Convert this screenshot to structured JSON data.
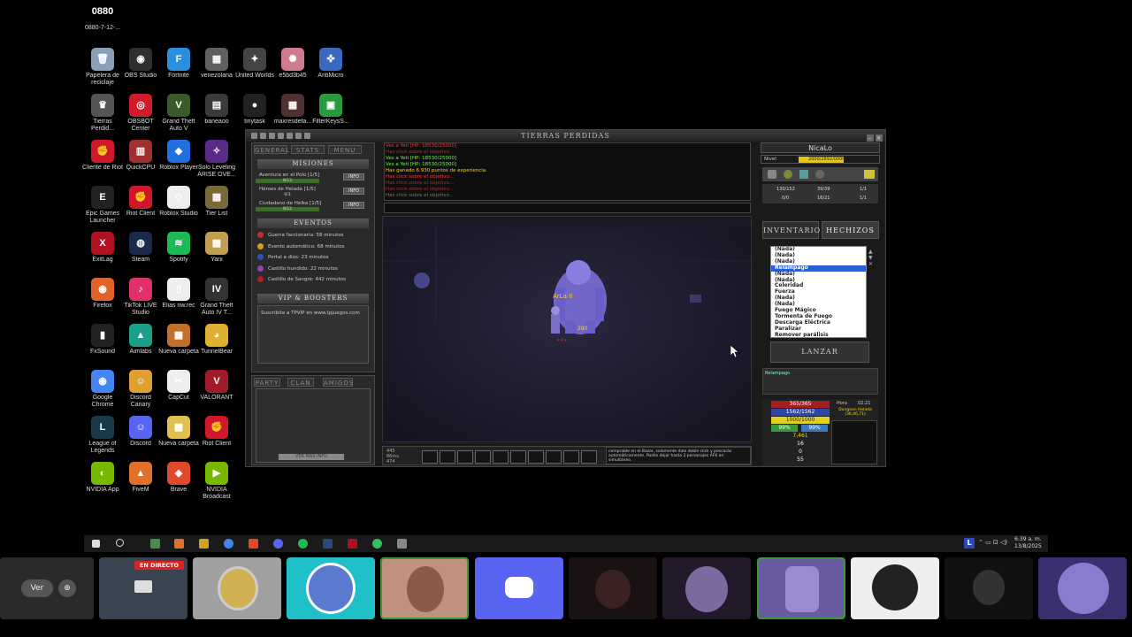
{
  "desktop_icons": [
    {
      "label": "Papelera de reciclaje",
      "color": "#8aa0b8",
      "glyph": "🗑"
    },
    {
      "label": "OBS Studio",
      "color": "#302e31",
      "glyph": "◉"
    },
    {
      "label": "Fortnite",
      "color": "#2b8fe0",
      "glyph": "F"
    },
    {
      "label": "venezolana",
      "color": "#606060",
      "glyph": "▦"
    },
    {
      "label": "United Worlds",
      "color": "#444",
      "glyph": "✦"
    },
    {
      "label": "e5bd3b45",
      "color": "#d07a90",
      "glyph": "✺"
    },
    {
      "label": "AntiMicro",
      "color": "#3a6ac0",
      "glyph": "✜"
    },
    {
      "label": "Tierras Perdid...",
      "color": "#555",
      "glyph": "♛"
    },
    {
      "label": "OBSBOT Center",
      "color": "#d01c2a",
      "glyph": "◎"
    },
    {
      "label": "Grand Theft Auto V",
      "color": "#3a5a2a",
      "glyph": "V"
    },
    {
      "label": "baneaoo",
      "color": "#3a3a3a",
      "glyph": "▤"
    },
    {
      "label": "tinytask",
      "color": "#222",
      "glyph": "●"
    },
    {
      "label": "maxresdefa...",
      "color": "#503030",
      "glyph": "▦"
    },
    {
      "label": "FilterKeysS...",
      "color": "#2a9a40",
      "glyph": "▣"
    },
    {
      "label": "Cliente de Riot",
      "color": "#d0182a",
      "glyph": "✊"
    },
    {
      "label": "QuickCPU",
      "color": "#a03030",
      "glyph": "▥"
    },
    {
      "label": "Roblox Player",
      "color": "#2070e0",
      "glyph": "◆"
    },
    {
      "label": "Solo Leveling ARISE OVE...",
      "color": "#5a2a8a",
      "glyph": "✧"
    },
    {
      "label": "Epic Games Launcher",
      "color": "#222",
      "glyph": "E"
    },
    {
      "label": "Riot Client",
      "color": "#d0182a",
      "glyph": "✊"
    },
    {
      "label": "Roblox Studio",
      "color": "#eee",
      "glyph": "◇"
    },
    {
      "label": "Tier List",
      "color": "#7a6a3a",
      "glyph": "▦"
    },
    {
      "label": "ExitLag",
      "color": "#b01020",
      "glyph": "X"
    },
    {
      "label": "Steam",
      "color": "#1a2a4a",
      "glyph": "◍"
    },
    {
      "label": "Spotify",
      "color": "#1db954",
      "glyph": "≋"
    },
    {
      "label": "Yani",
      "color": "#c0a050",
      "glyph": "▦"
    },
    {
      "label": "Firefox",
      "color": "#e0642a",
      "glyph": "◉"
    },
    {
      "label": "TikTok LIVE Studio",
      "color": "#e0306a",
      "glyph": "♪"
    },
    {
      "label": "Elias nw.rec",
      "color": "#eee",
      "glyph": "▯"
    },
    {
      "label": "Grand Theft Auto IV T...",
      "color": "#333",
      "glyph": "IV"
    },
    {
      "label": "FxSound",
      "color": "#222",
      "glyph": "▮"
    },
    {
      "label": "Aimlabs",
      "color": "#1aa08a",
      "glyph": "▲"
    },
    {
      "label": "Nueva carpeta",
      "color": "#c0702a",
      "glyph": "▦"
    },
    {
      "label": "TunnelBear",
      "color": "#e0b030",
      "glyph": "◕"
    },
    {
      "label": "Google Chrome",
      "color": "#4285f4",
      "glyph": "◉"
    },
    {
      "label": "Discord Canary",
      "color": "#e0a030",
      "glyph": "☺"
    },
    {
      "label": "CapCut",
      "color": "#eee",
      "glyph": "✂"
    },
    {
      "label": "VALORANT",
      "color": "#a01a2a",
      "glyph": "V"
    },
    {
      "label": "League of Legends",
      "color": "#1a3a4a",
      "glyph": "L"
    },
    {
      "label": "Discord",
      "color": "#5865f2",
      "glyph": "☺"
    },
    {
      "label": "Nueva carpeta",
      "color": "#e0c050",
      "glyph": "▦"
    },
    {
      "label": "Riot Client",
      "color": "#d0182a",
      "glyph": "✊"
    },
    {
      "label": "NVIDIA App",
      "color": "#76b900",
      "glyph": "◐"
    },
    {
      "label": "FiveM",
      "color": "#e0702a",
      "glyph": "▲"
    },
    {
      "label": "Brave",
      "color": "#e04a2a",
      "glyph": "◈"
    },
    {
      "label": "NVIDIA Broadcast",
      "color": "#76b900",
      "glyph": "▶"
    },
    {
      "label": "0880-7-12-...",
      "color": "#000",
      "glyph": "0880"
    }
  ],
  "game": {
    "title": "TIERRAS PERDIDAS",
    "tabs": [
      "GENERAL",
      "STATS",
      "MENU"
    ],
    "missions_header": "MISIONES",
    "missions": [
      {
        "name": "Aventura en el Polo [1/5]",
        "progress": "8/13",
        "fill": 1.0
      },
      {
        "name": "Héroes de Helada [1/5]",
        "progress": "0/3",
        "fill": 0
      },
      {
        "name": "Ciudadano de Helka [1/5]",
        "progress": "8/12",
        "fill": 1.0
      }
    ],
    "info_label": "INFO",
    "events_header": "EVENTOS",
    "events": [
      {
        "text": "Guerra faccionaria: 58 minutos",
        "color": "#c03030"
      },
      {
        "text": "Evento automático: 68 minutos",
        "color": "#d0a020"
      },
      {
        "text": "Portal a dios: 23 minutos",
        "color": "#3050c0"
      },
      {
        "text": "Castillo hundido: 22 minutos",
        "color": "#9040b0"
      },
      {
        "text": "Castillo de Sangre: 442 minutos",
        "color": "#b02020"
      }
    ],
    "vip_header": "VIP & BOOSTERS",
    "vip_text": "Suscribite a TPVIP en www.tpjuegos.com",
    "bottom_tabs": [
      "PARTY",
      "CLAN",
      "AMIGOS"
    ],
    "bottom_btn": "VER MÁS INFO",
    "chat": [
      {
        "text": "Ves a Yeti [HP: 18530/25000]",
        "color": "#ff3030"
      },
      {
        "text": "Has click sobre el objetivo...",
        "color": "#884444"
      },
      {
        "text": "Ves a Yeti [HP: 18530/25000]",
        "color": "#60ff40"
      },
      {
        "text": "Ves a Yeti [HP: 18530/25000]",
        "color": "#60ff40"
      },
      {
        "text": "Has ganado 6.930 puntos de experiencia.",
        "color": "#ffd400"
      },
      {
        "text": "Has click sobre el objetivo...",
        "color": "#ff3030"
      },
      {
        "text": "Has click sobre el objetivo...",
        "color": "#a03030"
      },
      {
        "text": "Has click sobre el objetivo...",
        "color": "#a03030"
      },
      {
        "text": "Has click sobre el objetivo...",
        "color": "#777"
      }
    ],
    "map_labels": {
      "player": "ArLa II",
      "damage": "280"
    },
    "ping": [
      "445",
      "86ms",
      "474"
    ],
    "tip": "comprable en el Bazar, solamente dale doble click y pescarás automáticamente. Podés dejar hasta 2 personajes AFK en simultáneo.",
    "char_name": "NicaLo",
    "level_label": "Nivel",
    "exp_text": "2000/2892/0000 [57.57%]",
    "exp_fill": 0.5757,
    "stats_small": [
      "130/152",
      "39/39",
      "1/1",
      "0/0",
      "16/21",
      "1/1"
    ],
    "inventory_tab": "INVENTARIO",
    "spells_tab": "HECHIZOS",
    "spells": [
      {
        "name": "(Nada)",
        "selected": false
      },
      {
        "name": "(Nada)",
        "selected": false
      },
      {
        "name": "(Nada)",
        "selected": false
      },
      {
        "name": "Relampago",
        "selected": true
      },
      {
        "name": "(Nada)",
        "selected": false
      },
      {
        "name": "(Nada)",
        "selected": false
      },
      {
        "name": "Celeridad",
        "selected": false
      },
      {
        "name": "Fuerza",
        "selected": false
      },
      {
        "name": "(Nada)",
        "selected": false
      },
      {
        "name": "(Nada)",
        "selected": false
      },
      {
        "name": "Fuego Mágico",
        "selected": false
      },
      {
        "name": "Tormenta de Fuego",
        "selected": false
      },
      {
        "name": "Descarga Eléctrica",
        "selected": false
      },
      {
        "name": "Paralizar",
        "selected": false
      },
      {
        "name": "Remover parálisis",
        "selected": false
      }
    ],
    "cast_btn": "LANZAR",
    "spell_desc": "Relampago",
    "hp": "365/365",
    "mana": "1562/1562",
    "stamina": "1000/1000",
    "hunger": "99%",
    "thirst": "99%",
    "gold": "7,461",
    "stat_a": "16",
    "stat_b": "0",
    "stat_c": "55",
    "time_label": "Hora",
    "time_value": "02:21",
    "zone": "Dungeon Helada (36,46,71)"
  },
  "taskbar": {
    "lang": "L",
    "time": "6:39 a. m.",
    "date": "13/8/2025"
  },
  "stream": {
    "ver_label": "Ver",
    "live_badge": "EN DIRECTO"
  }
}
